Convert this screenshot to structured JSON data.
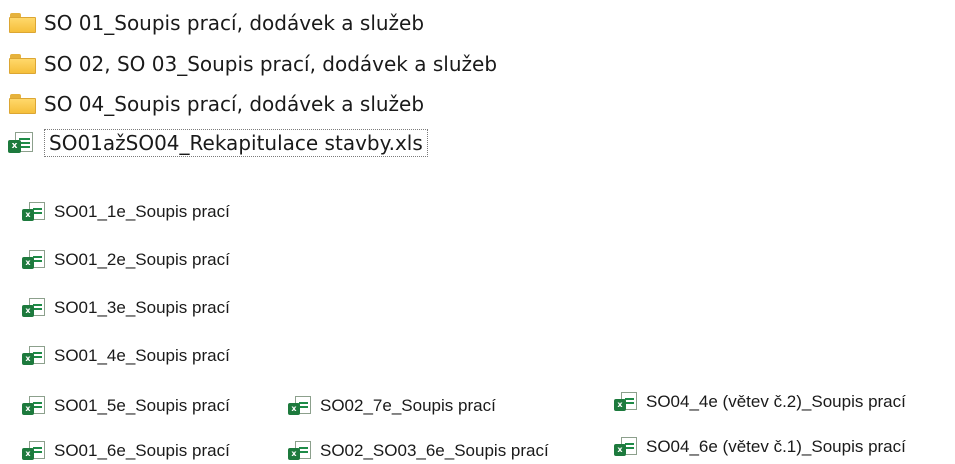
{
  "folders": [
    {
      "label": "SO 01_Soupis prací, dodávek a služeb",
      "icon": "folder-icon"
    },
    {
      "label": "SO 02, SO 03_Soupis prací, dodávek a služeb",
      "icon": "folder-icon"
    },
    {
      "label": "SO 04_Soupis prací, dodávek a služeb",
      "icon": "folder-icon"
    }
  ],
  "selected_file": {
    "label": "SO01ažSO04_Rekapitulace stavby.xls",
    "icon": "excel-file-icon"
  },
  "excel_badge": "x",
  "files": {
    "column1": [
      "SO01_1e_Soupis prací",
      "SO01_2e_Soupis prací",
      "SO01_3e_Soupis prací",
      "SO01_4e_Soupis prací",
      "SO01_5e_Soupis prací",
      "SO01_6e_Soupis prací"
    ],
    "column2": [
      "SO02_7e_Soupis prací",
      "SO02_SO03_6e_Soupis prací"
    ],
    "column3": [
      "SO04_4e (větev č.2)_Soupis prací",
      "SO04_6e (větev č.1)_Soupis prací"
    ]
  },
  "colors": {
    "folder": "#f5bf3b",
    "excel_green": "#1d7a3d"
  }
}
